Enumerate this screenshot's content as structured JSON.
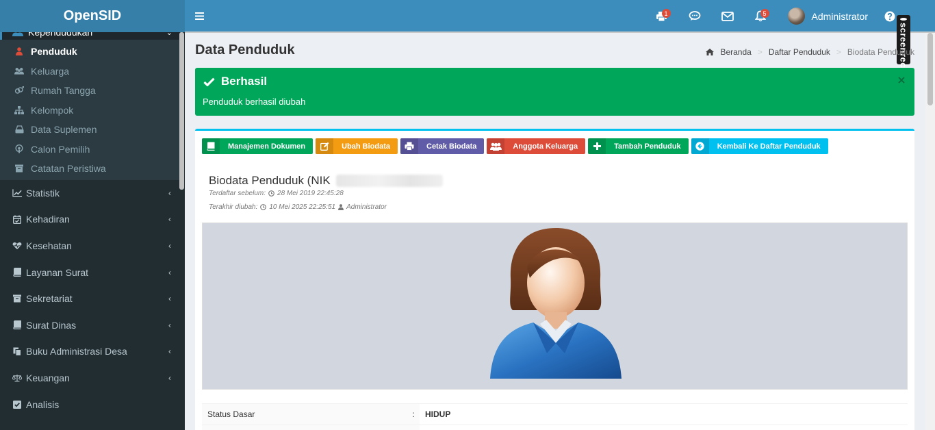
{
  "app": {
    "brand": "OpenSID"
  },
  "header": {
    "menu_icon": "hamburger-icon",
    "print_badge": "1",
    "notif_badge": "5",
    "user_name": "Administrator"
  },
  "recorder": {
    "label": "screenrec"
  },
  "sidebar": {
    "parent": {
      "label": "Kependudukan",
      "icon": "users-icon"
    },
    "sub_items": [
      {
        "label": "Penduduk",
        "icon": "user-icon",
        "active": true
      },
      {
        "label": "Keluarga",
        "icon": "family-icon"
      },
      {
        "label": "Rumah Tangga",
        "icon": "venus-mars-icon"
      },
      {
        "label": "Kelompok",
        "icon": "sitemap-icon"
      },
      {
        "label": "Data Suplemen",
        "icon": "hdd-icon"
      },
      {
        "label": "Calon Pemilih",
        "icon": "podcast-icon"
      },
      {
        "label": "Catatan Peristiwa",
        "icon": "archive-icon"
      }
    ],
    "items": [
      {
        "label": "Statistik",
        "icon": "line-chart-icon"
      },
      {
        "label": "Kehadiran",
        "icon": "calendar-check-icon"
      },
      {
        "label": "Kesehatan",
        "icon": "heartbeat-icon"
      },
      {
        "label": "Layanan Surat",
        "icon": "book-icon"
      },
      {
        "label": "Sekretariat",
        "icon": "archive-icon"
      },
      {
        "label": "Surat Dinas",
        "icon": "book-icon"
      },
      {
        "label": "Buku Administrasi Desa",
        "icon": "copy-icon"
      },
      {
        "label": "Keuangan",
        "icon": "balance-scale-icon"
      },
      {
        "label": "Analisis",
        "icon": "check-square-icon"
      }
    ]
  },
  "page": {
    "title": "Data Penduduk",
    "breadcrumb": [
      "Beranda",
      "Daftar Penduduk",
      "Biodata Penduduk"
    ]
  },
  "alert": {
    "title": "Berhasil",
    "message": "Penduduk berhasil diubah",
    "color": "#00a65a"
  },
  "toolbar": {
    "buttons": [
      {
        "label": "Manajemen Dokumen",
        "color": "#00a65a",
        "icon": "book-icon"
      },
      {
        "label": "Ubah Biodata",
        "color": "#f39c12",
        "icon": "edit-icon"
      },
      {
        "label": "Cetak Biodata",
        "color": "#605ca8",
        "icon": "print-icon"
      },
      {
        "label": "Anggota Keluarga",
        "color": "#dd4b39",
        "icon": "users-icon"
      },
      {
        "label": "Tambah Penduduk",
        "color": "#00a65a",
        "icon": "plus-icon"
      },
      {
        "label": "Kembali Ke Daftar Penduduk",
        "color": "#00c0ef",
        "icon": "arrow-circle-left-icon"
      }
    ]
  },
  "biodata": {
    "title": "Biodata Penduduk (NIK",
    "registered_label": "Terdaftar sebelum:",
    "registered_date": "28 Mei 2019 22:45:28",
    "modified_label": "Terakhir diubah:",
    "modified_date": "10 Mei 2025 22:25:51",
    "modified_by": "Administrator"
  },
  "status": {
    "label": "Status Dasar",
    "separator": ":",
    "value": "HIDUP"
  }
}
